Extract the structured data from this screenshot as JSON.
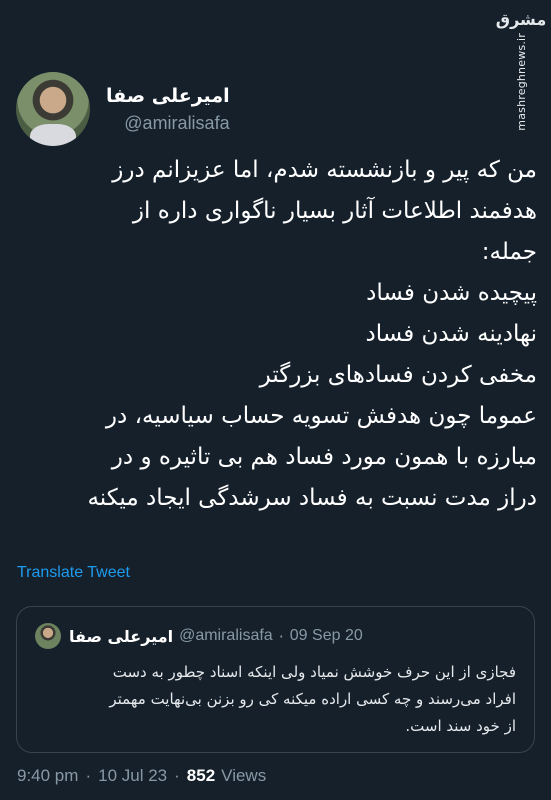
{
  "watermark": {
    "logo": "مشرق",
    "url": "mashreghnews.ir"
  },
  "tweet": {
    "author_name": "امیرعلی صفا",
    "author_handle": "@amiralisafa",
    "lines": [
      "من که پیر و بازنشسته شدم، اما عزیزانم درز",
      "هدفمند اطلاعات آثار بسیار ناگواری داره از",
      "جمله:",
      "پیچیده شدن فساد",
      "نهادینه شدن فساد",
      "مخفی کردن فسادهای بزرگتر",
      "عموما چون هدفش تسویه حساب سیاسیه، در",
      "مبارزه با همون مورد فساد هم بی تاثیره و در",
      "دراز مدت نسبت به فساد سرشدگی ایجاد میکنه"
    ],
    "translate_label": "Translate Tweet",
    "time": "9:40 pm",
    "date": "10 Jul 23",
    "separator": "·",
    "views_count": "852",
    "views_label": "Views"
  },
  "quoted_tweet": {
    "author_name": "امیرعلی صفا",
    "author_handle": "@amiralisafa",
    "separator": "·",
    "date": "09 Sep 20",
    "lines": [
      "فجازی از این حرف خوشش نمیاد ولی اینکه اسناد چطور به دست",
      "افراد می‌رسند و چه کسی اراده میکنه کی رو بزنن بی‌نهایت مهمتر",
      "از خود سند است."
    ]
  },
  "colors": {
    "background": "#15202b",
    "text_primary": "#ffffff",
    "text_secondary": "#8899a6",
    "link": "#1d9bf0",
    "border": "#38444d"
  }
}
